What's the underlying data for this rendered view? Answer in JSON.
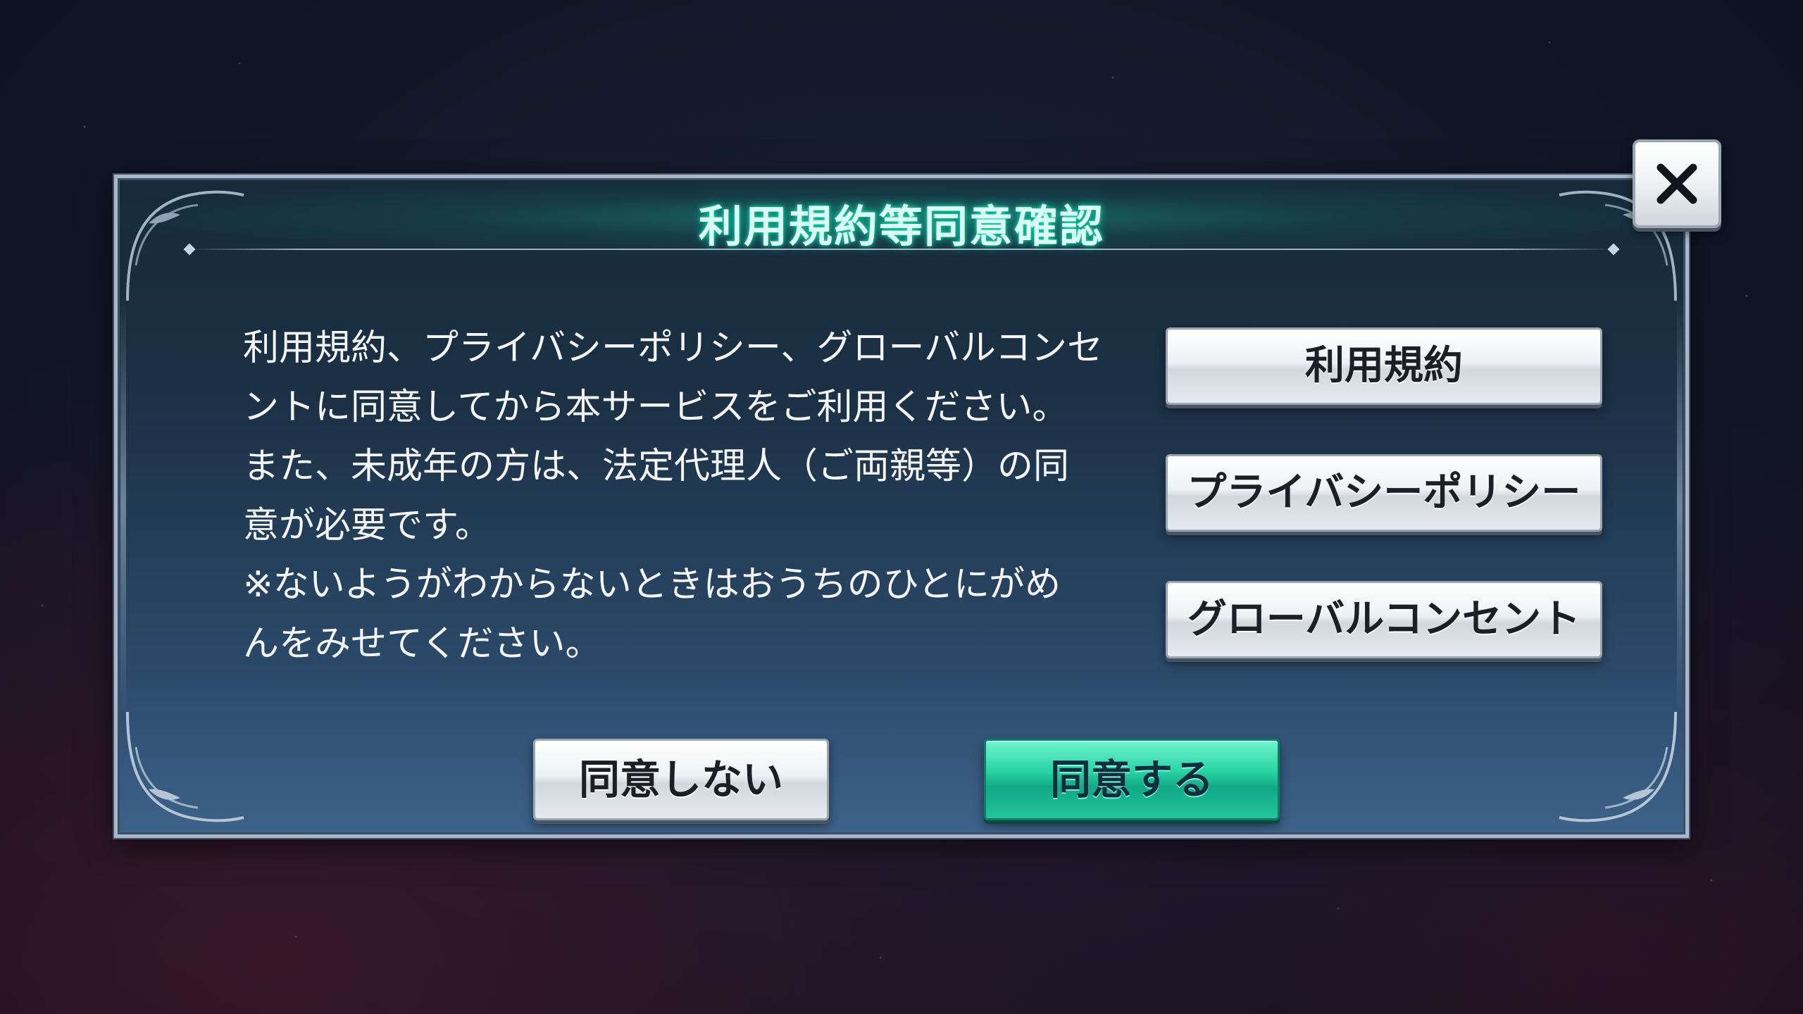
{
  "dialog": {
    "title": "利用規約等同意確認",
    "body_lines": [
      "利用規約、プライバシーポリシー、グローバルコンセ",
      "ントに同意してから本サービスをご利用ください。",
      "また、未成年の方は、法定代理人（ご両親等）の同",
      "意が必要です。",
      "※ないようがわからないときはおうちのひとにがめ",
      "んをみせてください。"
    ],
    "buttons": {
      "terms": "利用規約",
      "privacy": "プライバシーポリシー",
      "global_consent": "グローバルコンセント",
      "decline": "同意しない",
      "agree": "同意する"
    },
    "close_icon": "close-icon"
  },
  "colors": {
    "title_glow": "#1fe0b5",
    "agree_button": "#29d3a4",
    "panel": "#1c3146"
  }
}
